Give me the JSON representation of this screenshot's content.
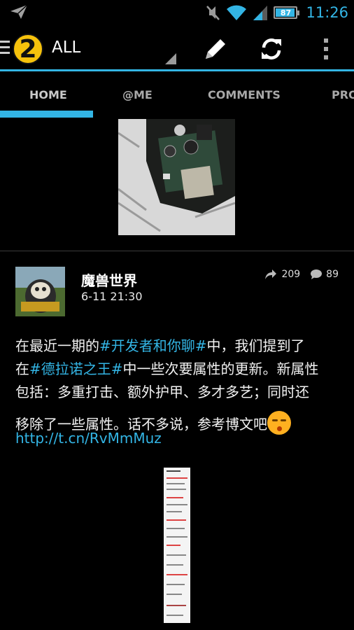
{
  "status_bar": {
    "time": "11:26",
    "battery_level": "87",
    "icons": [
      "send-icon",
      "mute-icon",
      "wifi-icon",
      "signal-icon",
      "battery-icon"
    ]
  },
  "action_bar": {
    "account_badge": "2",
    "account_label": "ALL",
    "icons": [
      "menu-icon",
      "compose-icon",
      "refresh-icon",
      "overflow-icon"
    ]
  },
  "tabs": [
    {
      "label": "HOME",
      "active": true
    },
    {
      "label": "@ME",
      "active": false
    },
    {
      "label": "COMMENTS",
      "active": false
    },
    {
      "label": "PRO",
      "active": false
    }
  ],
  "post": {
    "author": "魔兽世界",
    "time": "6-11 21:30",
    "reposts": "209",
    "comments": "89",
    "text": {
      "l1_a": "在最近一期的",
      "l1_tag": "#开发者和你聊#",
      "l1_b": "中，我们提到了",
      "l2_a": "在",
      "l2_tag": "#德拉诺之王#",
      "l2_b": "中一些次要属性的更新。新属性",
      "l3": "包括：多重打击、额外护甲、多才多艺；同时还",
      "l4": "移除了一些属性。话不多说，参考博文吧"
    },
    "link": "http://t.cn/RvMmMuz"
  },
  "colors": {
    "accent": "#33b5e5",
    "badge": "#f6c20c",
    "background": "#000000"
  }
}
